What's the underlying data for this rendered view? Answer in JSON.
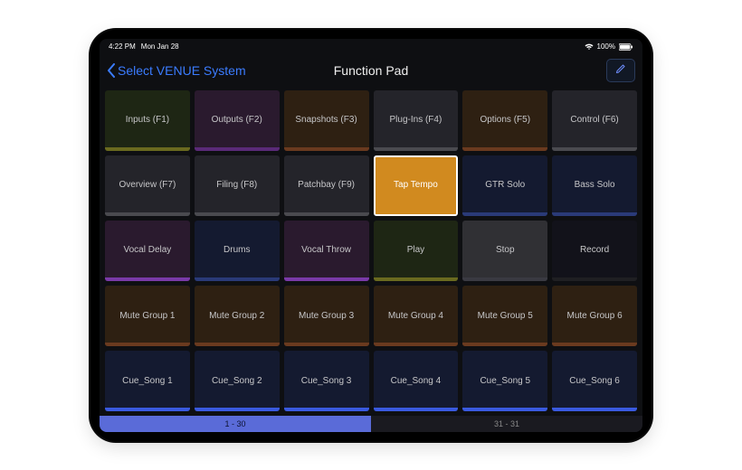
{
  "status": {
    "time": "4:22 PM",
    "date": "Mon Jan 28",
    "battery": "100%"
  },
  "nav": {
    "back": "Select VENUE System",
    "title": "Function Pad"
  },
  "pager": [
    "1 - 30",
    "31 - 31"
  ],
  "colors": {
    "pad_bg_default": "#2a2a2e",
    "accents": {
      "olive": "#6a6a1f",
      "brown": "#6a3a1f",
      "grey": "#4a4a4f",
      "purple": "#5a2a78",
      "orange": "#d18a1f",
      "blue": "#2a3a78",
      "dark": "#1f1f22",
      "violet": "#7a3aa8",
      "slate": "#3a3a42",
      "bluebar": "#3a5ae0"
    }
  },
  "pads": [
    {
      "label": "Inputs (F1)",
      "bg": "#1e2614",
      "accent": "olive"
    },
    {
      "label": "Outputs (F2)",
      "bg": "#2a1a2e",
      "accent": "purple"
    },
    {
      "label": "Snapshots (F3)",
      "bg": "#2e2012",
      "accent": "brown"
    },
    {
      "label": "Plug-Ins (F4)",
      "bg": "#24242a",
      "accent": "grey"
    },
    {
      "label": "Options (F5)",
      "bg": "#2e2012",
      "accent": "brown"
    },
    {
      "label": "Control (F6)",
      "bg": "#24242a",
      "accent": "grey"
    },
    {
      "label": "Overview (F7)",
      "bg": "#24242a",
      "accent": "grey"
    },
    {
      "label": "Filing (F8)",
      "bg": "#24242a",
      "accent": "grey"
    },
    {
      "label": "Patchbay (F9)",
      "bg": "#24242a",
      "accent": "grey"
    },
    {
      "label": "Tap Tempo",
      "bg": "#d18a1f",
      "accent": "orange",
      "active": true
    },
    {
      "label": "GTR Solo",
      "bg": "#141a30",
      "accent": "blue"
    },
    {
      "label": "Bass Solo",
      "bg": "#141a30",
      "accent": "blue"
    },
    {
      "label": "Vocal Delay",
      "bg": "#2a1a2e",
      "accent": "violet"
    },
    {
      "label": "Drums",
      "bg": "#141a30",
      "accent": "blue"
    },
    {
      "label": "Vocal Throw",
      "bg": "#2a1a2e",
      "accent": "violet"
    },
    {
      "label": "Play",
      "bg": "#1e2614",
      "accent": "olive"
    },
    {
      "label": "Stop",
      "bg": "#303034",
      "accent": "slate"
    },
    {
      "label": "Record",
      "bg": "#12121a",
      "accent": "dark"
    },
    {
      "label": "Mute Group 1",
      "bg": "#2e2012",
      "accent": "brown"
    },
    {
      "label": "Mute Group 2",
      "bg": "#2e2012",
      "accent": "brown"
    },
    {
      "label": "Mute Group 3",
      "bg": "#2e2012",
      "accent": "brown"
    },
    {
      "label": "Mute Group 4",
      "bg": "#2e2012",
      "accent": "brown"
    },
    {
      "label": "Mute Group 5",
      "bg": "#2e2012",
      "accent": "brown"
    },
    {
      "label": "Mute Group 6",
      "bg": "#2e2012",
      "accent": "brown"
    },
    {
      "label": "Cue_Song 1",
      "bg": "#141a30",
      "accent": "bluebar"
    },
    {
      "label": "Cue_Song 2",
      "bg": "#141a30",
      "accent": "bluebar"
    },
    {
      "label": "Cue_Song 3",
      "bg": "#141a30",
      "accent": "bluebar"
    },
    {
      "label": "Cue_Song 4",
      "bg": "#141a30",
      "accent": "bluebar"
    },
    {
      "label": "Cue_Song 5",
      "bg": "#141a30",
      "accent": "bluebar"
    },
    {
      "label": "Cue_Song 6",
      "bg": "#141a30",
      "accent": "bluebar"
    }
  ]
}
